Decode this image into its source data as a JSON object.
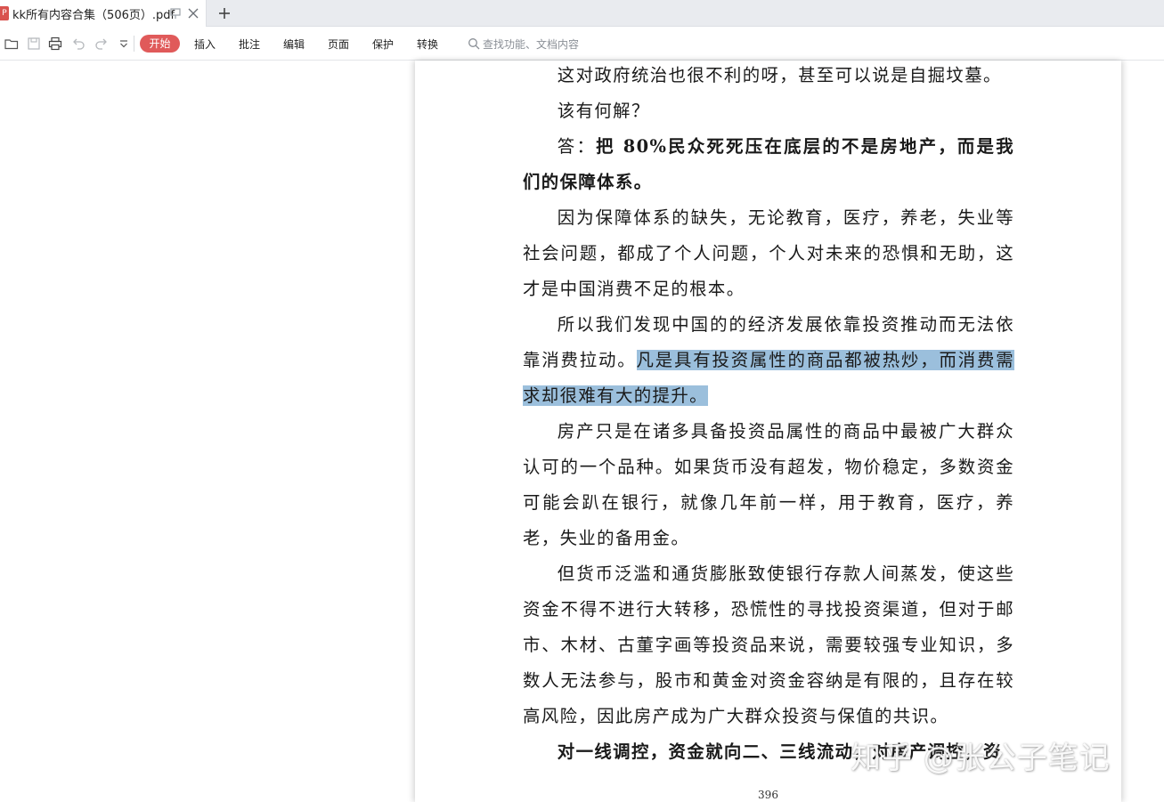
{
  "tab": {
    "icon_letter": "P",
    "title": "kk所有内容合集（506页）.pdf"
  },
  "toolbar": {
    "menu": [
      "开始",
      "插入",
      "批注",
      "编辑",
      "页面",
      "保护",
      "转换"
    ],
    "search_placeholder": "查找功能、文档内容"
  },
  "document": {
    "paragraphs": [
      {
        "text": "这对政府统治也很不利的呀，甚至可以说是自掘坟墓。",
        "bold": false
      },
      {
        "text": "该有何解？",
        "bold": false
      },
      {
        "text_plain": "答：",
        "text_bold": "把 80%民众死死压在底层的不是房地产，而是我们的保障体系。"
      },
      {
        "text": "因为保障体系的缺失，无论教育，医疗，养老，失业等社会问题，都成了个人问题，个人对未来的恐惧和无助，这才是中国消费不足的根本。",
        "bold": false
      },
      {
        "text_before": "所以我们发现中国的的经济发展依靠投资推动而无法依靠消费拉动。",
        "text_highlight": "凡是具有投资属性的商品都被热炒，而消费需求却很难有大的提升。"
      },
      {
        "text": "房产只是在诸多具备投资品属性的商品中最被广大群众认可的一个品种。如果货币没有超发，物价稳定，多数资金可能会趴在银行，就像几年前一样，用于教育，医疗，养老，失业的备用金。",
        "bold": false
      },
      {
        "text": "但货币泛滥和通货膨胀致使银行存款人间蒸发，使这些资金不得不进行大转移，恐慌性的寻找投资渠道，但对于邮市、木材、古董字画等投资品来说，需要较强专业知识，多数人无法参与，股市和黄金对资金容纳是有限的，且存在较高风险，因此房产成为广大群众投资与保值的共识。",
        "bold": false
      },
      {
        "text": "对一线调控，资金就向二、三线流动，对房产调控，资",
        "bold": true
      }
    ],
    "page_number": "396"
  },
  "watermark": "知乎 @张公子笔记",
  "colors": {
    "accent": "#e05a5a",
    "highlight": "#9bbfdc"
  }
}
